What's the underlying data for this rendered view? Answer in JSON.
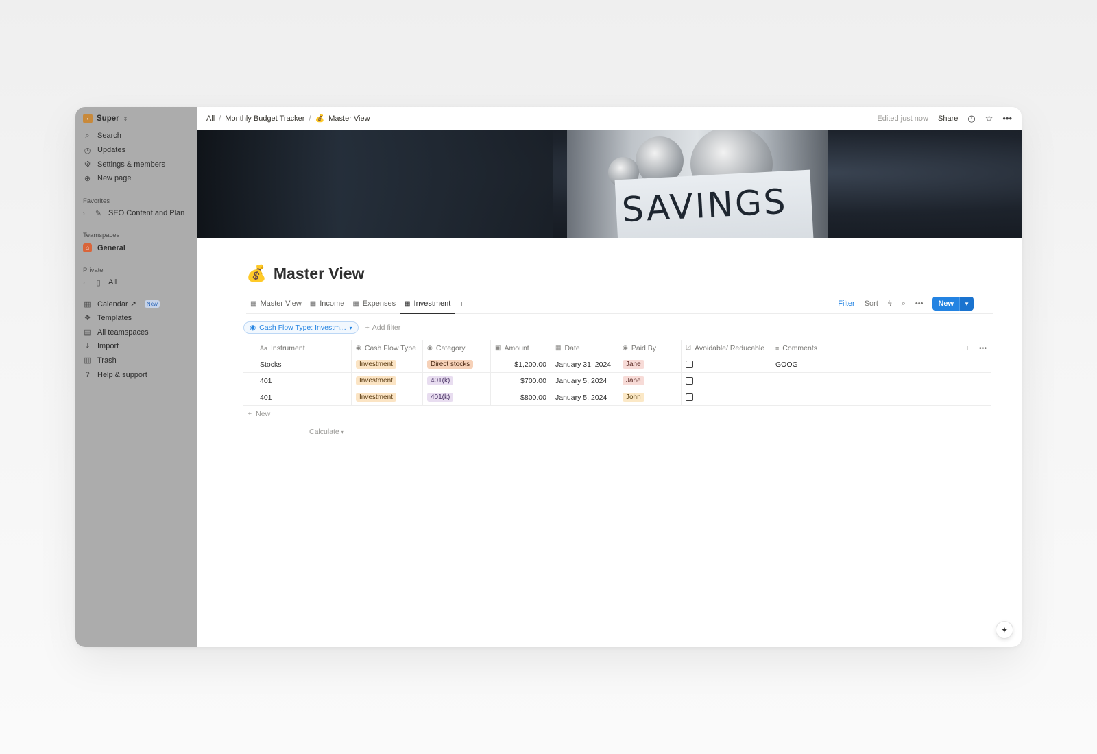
{
  "sidebar": {
    "workspace": {
      "logo": "•",
      "name": "Super",
      "caret": "⇕"
    },
    "top_items": [
      {
        "icon": "search-icon",
        "glyph": "⌕",
        "label": "Search"
      },
      {
        "icon": "clock-icon",
        "glyph": "◷",
        "label": "Updates"
      },
      {
        "icon": "gear-icon",
        "glyph": "⚙",
        "label": "Settings & members"
      },
      {
        "icon": "plus-circle-icon",
        "glyph": "⊕",
        "label": "New page"
      }
    ],
    "favorites_heading": "Favorites",
    "favorites": [
      {
        "label": "SEO Content and Plan"
      }
    ],
    "teamspaces_heading": "Teamspaces",
    "teamspaces": [
      {
        "label": "General"
      }
    ],
    "private_heading": "Private",
    "private": [
      {
        "label": "All"
      }
    ],
    "bottom_items": [
      {
        "label": "Calendar ↗",
        "badge": "New"
      },
      {
        "label": "Templates"
      },
      {
        "label": "All teamspaces"
      },
      {
        "label": "Import"
      },
      {
        "label": "Trash"
      },
      {
        "label": "Help & support"
      }
    ]
  },
  "topbar": {
    "breadcrumbs": [
      "All",
      "Monthly Budget Tracker",
      "Master View"
    ],
    "breadcrumb_emoji": "💰",
    "edited": "Edited just now",
    "share": "Share"
  },
  "cover": {
    "text": "SAVINGS"
  },
  "page": {
    "emoji": "💰",
    "title": "Master View"
  },
  "views": {
    "tabs": [
      {
        "label": "Master View",
        "active": false
      },
      {
        "label": "Income",
        "active": false
      },
      {
        "label": "Expenses",
        "active": false
      },
      {
        "label": "Investment",
        "active": true
      }
    ],
    "filter": "Filter",
    "sort": "Sort",
    "new": "New"
  },
  "filters": {
    "chip": "Cash Flow Type: Investm...",
    "add": "Add filter"
  },
  "table": {
    "columns": [
      {
        "icon": "Aa",
        "label": "Instrument"
      },
      {
        "icon": "◉",
        "label": "Cash Flow Type"
      },
      {
        "icon": "◉",
        "label": "Category"
      },
      {
        "icon": "▣",
        "label": "Amount"
      },
      {
        "icon": "▦",
        "label": "Date"
      },
      {
        "icon": "◉",
        "label": "Paid By"
      },
      {
        "icon": "☑",
        "label": "Avoidable/ Reducable"
      },
      {
        "icon": "≡",
        "label": "Comments"
      }
    ],
    "rows": [
      {
        "instrument": "Stocks",
        "cash_flow_type": "Investment",
        "category": "Direct stocks",
        "category_style": "peach",
        "amount": "$1,200.00",
        "date": "January 31, 2024",
        "paid_by": "Jane",
        "paid_style": "red",
        "avoidable": false,
        "comments": "GOOG"
      },
      {
        "instrument": "401",
        "cash_flow_type": "Investment",
        "category": "401(k)",
        "category_style": "purple",
        "amount": "$700.00",
        "date": "January 5, 2024",
        "paid_by": "Jane",
        "paid_style": "red",
        "avoidable": false,
        "comments": ""
      },
      {
        "instrument": "401",
        "cash_flow_type": "Investment",
        "category": "401(k)",
        "category_style": "purple",
        "amount": "$800.00",
        "date": "January 5, 2024",
        "paid_by": "John",
        "paid_style": "yellow",
        "avoidable": false,
        "comments": ""
      }
    ],
    "new_row": "New",
    "calculate": "Calculate"
  },
  "colors": {
    "accent": "#2383e2",
    "sidebar_bg": "#acacac"
  }
}
